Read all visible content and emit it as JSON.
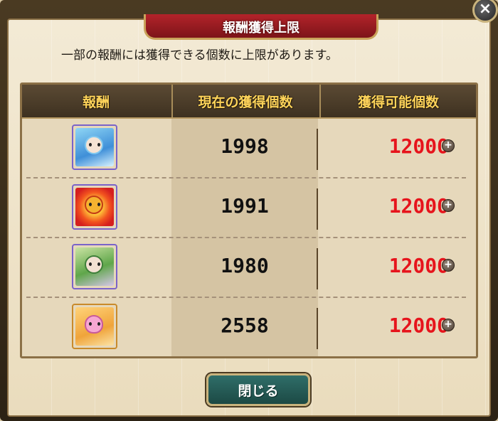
{
  "dialog": {
    "title": "報酬獲得上限",
    "close_icon_glyph": "×",
    "notice": "一部の報酬には獲得できる個数に上限があります。",
    "close_button_label": "閉じる"
  },
  "table": {
    "headers": [
      "報酬",
      "現在の獲得個数",
      "獲得可能個数"
    ],
    "rows": [
      {
        "icon": "water-girl-reward-icon",
        "current": "1998",
        "limit": "12000",
        "plus": "+"
      },
      {
        "icon": "flower-lion-reward-icon",
        "current": "1991",
        "limit": "12000",
        "plus": "+"
      },
      {
        "icon": "forest-girl-reward-icon",
        "current": "1980",
        "limit": "12000",
        "plus": "+"
      },
      {
        "icon": "pink-dragon-reward-icon",
        "current": "2558",
        "limit": "12000",
        "plus": "+"
      }
    ]
  },
  "colors": {
    "limit_text": "#e6141c",
    "header_text": "#ffd45a",
    "close_button": "#2f6e69"
  }
}
